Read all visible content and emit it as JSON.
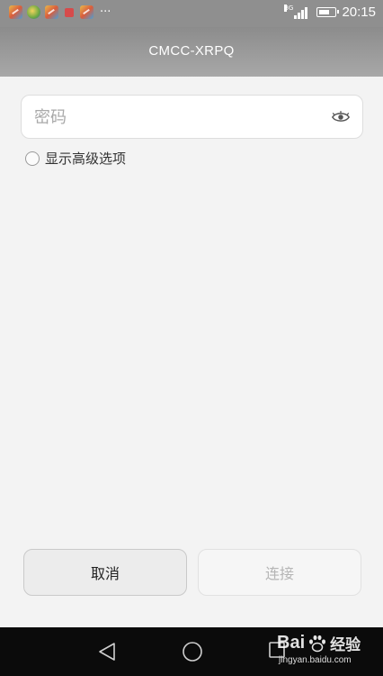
{
  "status_bar": {
    "overflow": "···",
    "network_type": "3G",
    "time": "20:15"
  },
  "header": {
    "title": "CMCC-XRPQ"
  },
  "password": {
    "placeholder": "密码",
    "value": ""
  },
  "advanced": {
    "label": "显示高级选项",
    "checked": false
  },
  "buttons": {
    "cancel_label": "取消",
    "connect_label": "连接"
  },
  "watermark": {
    "brand_prefix": "Bai",
    "brand_suffix": "经验",
    "url": "jingyan.baidu.com"
  },
  "colors": {
    "title_bar": "#9a9a9a",
    "background": "#f3f3f3",
    "nav_bar": "#0b0b0b"
  }
}
